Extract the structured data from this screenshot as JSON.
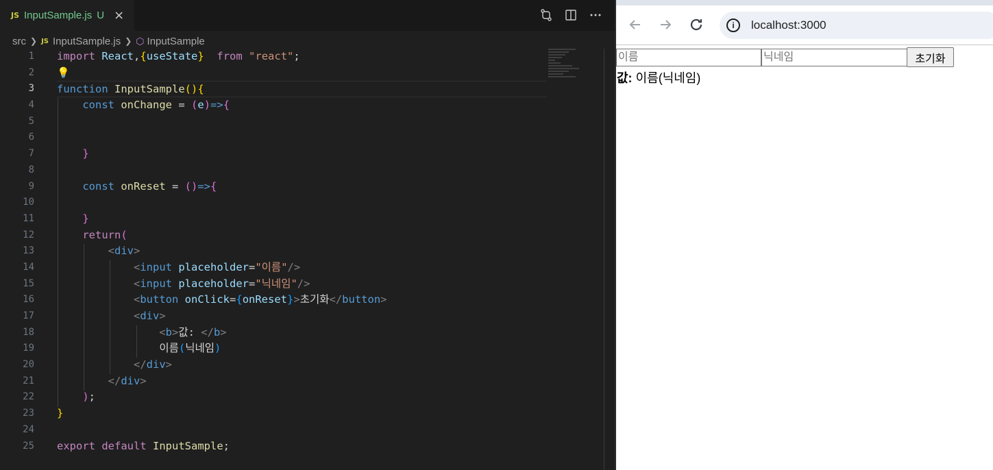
{
  "editor": {
    "tab": {
      "lang": "JS",
      "filename": "InputSample.js",
      "status": "U",
      "close": "×"
    },
    "breadcrumb": {
      "folder": "src",
      "lang": "JS",
      "file": "InputSample.js",
      "symbol": "InputSample"
    },
    "line_numbers": [
      "1",
      "2",
      "3",
      "4",
      "5",
      "6",
      "7",
      "8",
      "9",
      "10",
      "11",
      "12",
      "13",
      "14",
      "15",
      "16",
      "17",
      "18",
      "19",
      "20",
      "21",
      "22",
      "23",
      "24",
      "25"
    ],
    "active_line": "3",
    "code": {
      "l1": {
        "import": "import",
        "react": "React",
        "comma": ",",
        "ob": "{",
        "usestate": "useState",
        "cb": "}",
        "from": "from",
        "mod": "\"react\"",
        "semi": ";"
      },
      "l3": {
        "function": "function",
        "name": "InputSample",
        "paren": "()",
        "ob": "{"
      },
      "l4": {
        "const": "const",
        "name": "onChange",
        "eq": " = ",
        "po": "(",
        "e": "e",
        "pc": ")",
        "arrow": "=>",
        "ob": "{"
      },
      "l7": {
        "cb": "}"
      },
      "l9": {
        "const": "const",
        "name": "onReset",
        "eq": " = ",
        "paren": "()",
        "arrow": "=>",
        "ob": "{"
      },
      "l11": {
        "cb": "}"
      },
      "l12": {
        "return": "return",
        "po": "("
      },
      "l13": {
        "lt": "<",
        "tag": "div",
        "gt": ">"
      },
      "l14": {
        "lt": "<",
        "tag": "input",
        "attr": "placeholder",
        "eq": "=",
        "val": "\"이름\"",
        "end": "/>"
      },
      "l15": {
        "lt": "<",
        "tag": "input",
        "attr": "placeholder",
        "eq": "=",
        "val": "\"닉네임\"",
        "end": "/>"
      },
      "l16": {
        "lt": "<",
        "tag": "button",
        "attr": "onClick",
        "eq": "=",
        "ob": "{",
        "handler": "onReset",
        "cb": "}",
        "gt": ">",
        "text": "초기화",
        "close_lt": "</",
        "close_tag": "button",
        "close_gt": ">"
      },
      "l17": {
        "lt": "<",
        "tag": "div",
        "gt": ">"
      },
      "l18": {
        "lt": "<",
        "tag": "b",
        "gt": ">",
        "text": "값: ",
        "close_lt": "</",
        "close_tag": "b",
        "close_gt": ">"
      },
      "l19": {
        "text": "이름",
        "po": "(",
        "nick": "닉네임",
        "pc": ")"
      },
      "l20": {
        "close_lt": "</",
        "tag": "div",
        "gt": ">"
      },
      "l21": {
        "close_lt": "</",
        "tag": "div",
        "gt": ">"
      },
      "l22": {
        "pc": ")",
        "semi": ";"
      },
      "l23": {
        "cb": "}"
      },
      "l25": {
        "export": "export",
        "default": "default",
        "name": "InputSample",
        "semi": ";"
      }
    }
  },
  "browser": {
    "url": "localhost:3000",
    "name_placeholder": "이름",
    "nickname_placeholder": "닉네임",
    "reset_label": "초기화",
    "value_label": "값:",
    "value_text": "이름(닉네임)"
  },
  "colors": {
    "editor_bg": "#1f1f1f",
    "keyword": "#c586c0",
    "storage": "#569cd6",
    "function": "#dcdcaa",
    "string": "#ce9178",
    "variable": "#9cdcfe"
  }
}
